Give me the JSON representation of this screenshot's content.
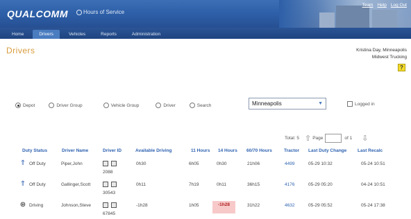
{
  "header": {
    "logo": "QUALCOMM",
    "app_name": "Hours of Service",
    "links": [
      "Team",
      "Help",
      "Log Out"
    ]
  },
  "nav": {
    "tabs": [
      "Home",
      "Drivers",
      "Vehicles",
      "Reports",
      "Administration"
    ],
    "active": "Drivers"
  },
  "page": {
    "title": "Drivers",
    "user_line1": "Kristina Day, Minneapolis",
    "user_line2": "Midwest Trucking",
    "help_label": "?"
  },
  "filters": {
    "options": [
      "Depot",
      "Driver Group",
      "Vehicle Group",
      "Driver",
      "Search"
    ],
    "selected": "Depot",
    "depot_value": "Minneapolis",
    "logged_in_label": "Logged in"
  },
  "pager": {
    "total": "Total: 5",
    "page_label": "Page",
    "page_value": "",
    "of_label": "of 1"
  },
  "table": {
    "columns": [
      "Duty Status",
      "Driver Name",
      "Driver ID",
      "Available Driving",
      "11 Hours",
      "14 Hours",
      "60/70 Hours",
      "Tractor",
      "Last Duty Change",
      "Last Recalc"
    ],
    "rows": [
      {
        "status": "Off Duty",
        "status_icon": "up-arrow-icon",
        "name": "Piper,John",
        "id": "2088",
        "available": "0h30",
        "h11": "6h05",
        "h14": "0h30",
        "h6070": "21h06",
        "tractor": "4499",
        "last_change": "05-29 10:32",
        "last_recalc": "05-24 10:51"
      },
      {
        "status": "Off Duty",
        "status_icon": "up-arrow-icon",
        "name": "Gallinger,Scott",
        "id": "30543",
        "available": "0h11",
        "h11": "7h19",
        "h14": "0h11",
        "h6070": "36h15",
        "tractor": "4176",
        "last_change": "05-29 05:20",
        "last_recalc": "04-24 10:51"
      },
      {
        "status": "Driving",
        "status_icon": "steering-wheel-icon",
        "name": "Johnson,Steve",
        "id": "67845",
        "available": "-1h28",
        "h11": "1h05",
        "h14": "-1h28",
        "h6070": "31h22",
        "tractor": "4632",
        "last_change": "05-29 05:52",
        "last_recalc": "05-24 17:38"
      }
    ]
  },
  "colors": {
    "header_blue": "#2d5fa8",
    "title_orange": "#d89a3a",
    "link_blue": "#2e62b0",
    "violation_bg": "#f7c9c9"
  }
}
